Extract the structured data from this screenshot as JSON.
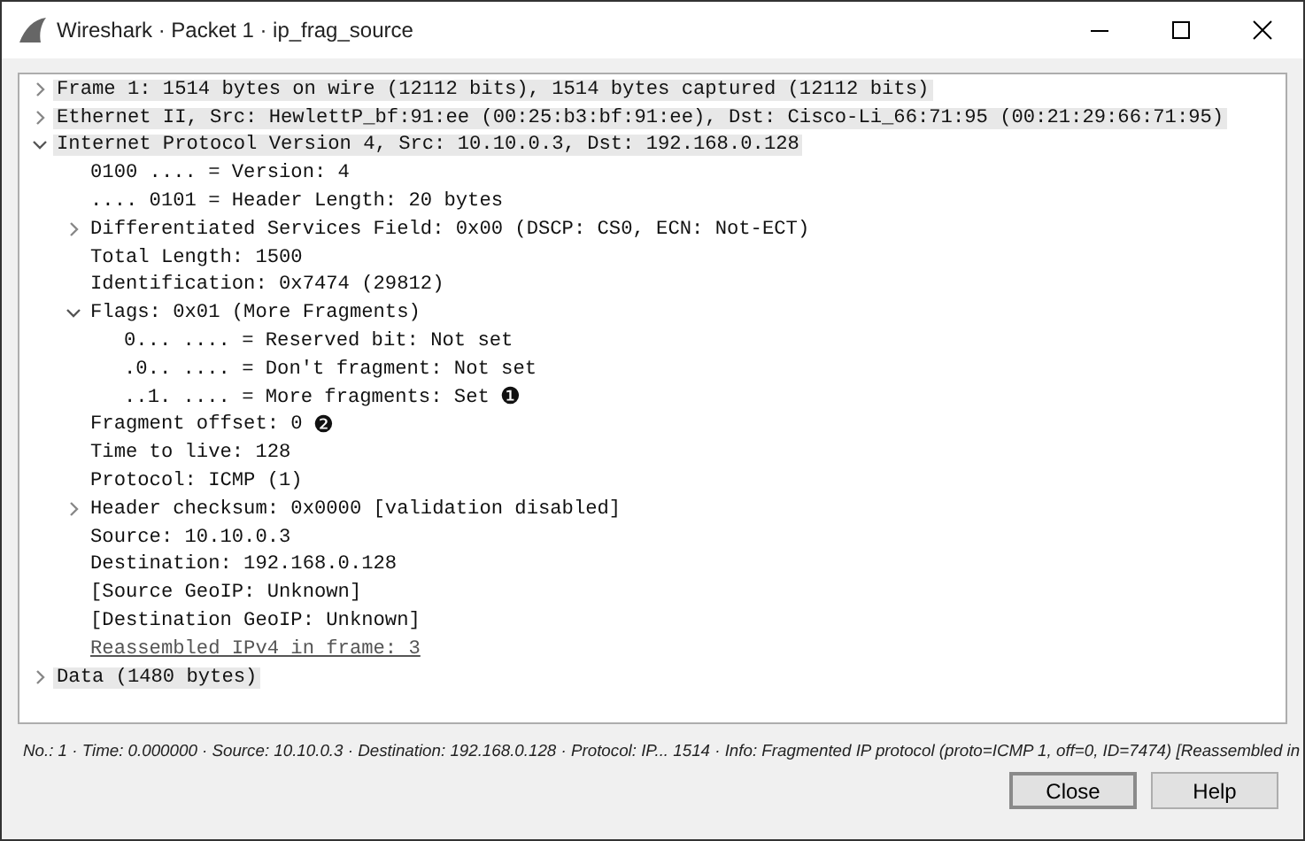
{
  "window": {
    "title": "Wireshark · Packet 1 · ip_frag_source"
  },
  "tree": [
    {
      "text": "Frame 1: 1514 bytes on wire (12112 bits), 1514 bytes captured (12112 bits)",
      "expanded": false
    },
    {
      "text": "Ethernet II, Src: HewlettP_bf:91:ee (00:25:b3:bf:91:ee), Dst: Cisco-Li_66:71:95 (00:21:29:66:71:95)",
      "expanded": false
    },
    {
      "text": "Internet Protocol Version 4, Src: 10.10.0.3, Dst: 192.168.0.128",
      "expanded": true,
      "children": [
        {
          "text": "0100 .... = Version: 4"
        },
        {
          "text": ".... 0101 = Header Length: 20 bytes"
        },
        {
          "text": "Differentiated Services Field: 0x00 (DSCP: CS0, ECN: Not-ECT)",
          "expanded": false
        },
        {
          "text": "Total Length: 1500"
        },
        {
          "text": "Identification: 0x7474 (29812)"
        },
        {
          "text": "Flags: 0x01 (More Fragments)",
          "expanded": true,
          "children": [
            {
              "text": "0... .... = Reserved bit: Not set"
            },
            {
              "text": ".0.. .... = Don't fragment: Not set"
            },
            {
              "text": "..1. .... = More fragments: Set",
              "marker": "❶"
            }
          ]
        },
        {
          "text": "Fragment offset: 0",
          "marker": "❷"
        },
        {
          "text": "Time to live: 128"
        },
        {
          "text": "Protocol: ICMP (1)"
        },
        {
          "text": "Header checksum: 0x0000 [validation disabled]",
          "expanded": false
        },
        {
          "text": "Source: 10.10.0.3"
        },
        {
          "text": "Destination: 192.168.0.128"
        },
        {
          "text": "[Source GeoIP: Unknown]"
        },
        {
          "text": "[Destination GeoIP: Unknown]"
        },
        {
          "text": "Reassembled IPv4 in frame: 3",
          "kind": "link"
        }
      ]
    },
    {
      "text": "Data (1480 bytes)",
      "expanded": false
    }
  ],
  "status": "No.: 1 · Time: 0.000000 · Source: 10.10.0.3 · Destination: 192.168.0.128 · Protocol: IP... 1514 · Info: Fragmented IP protocol (proto=ICMP 1, off=0, ID=7474) [Reassembled in",
  "buttons": [
    "Close",
    "Help"
  ]
}
